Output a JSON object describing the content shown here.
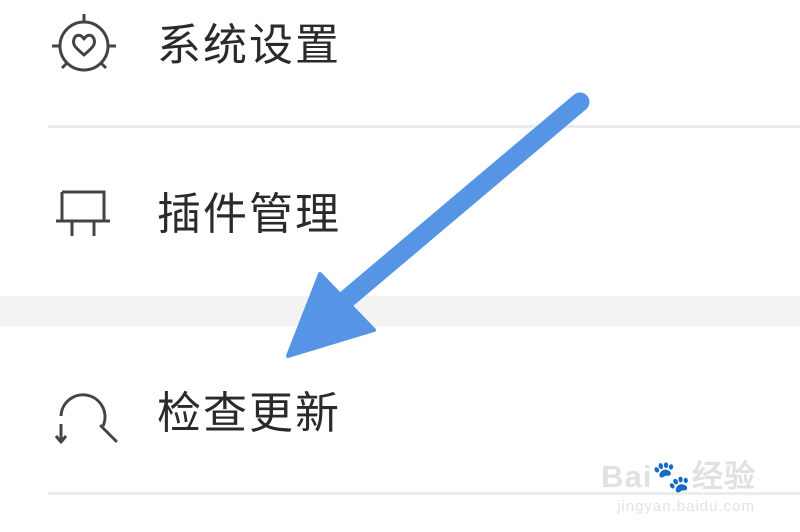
{
  "menu": {
    "items": [
      {
        "label": "系统设置",
        "icon": "settings-heart-icon"
      },
      {
        "label": "插件管理",
        "icon": "plugin-icon"
      },
      {
        "label": "检查更新",
        "icon": "check-update-icon"
      }
    ]
  },
  "overlay": {
    "arrow_color": "#5695e6"
  },
  "watermark": {
    "brand": "Bai",
    "brand_suffix": "经验",
    "url": "jingyan.baidu.com"
  }
}
